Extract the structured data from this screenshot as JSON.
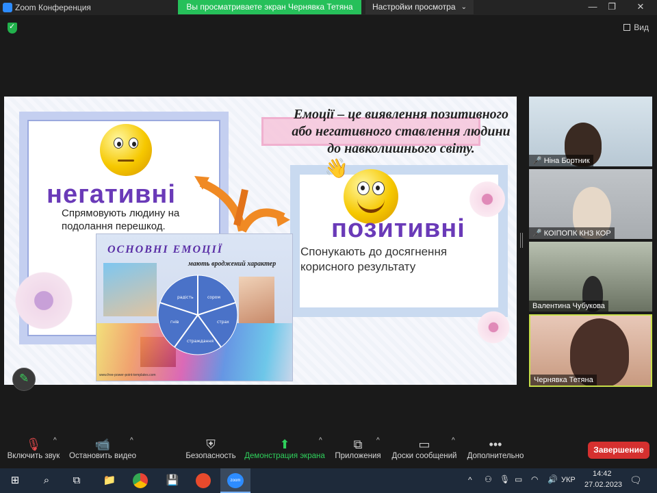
{
  "window": {
    "title": "Zoom Конференция",
    "share_banner": "Вы просматриваете экран Чернявка Тетяна",
    "view_settings": "Настройки просмотра",
    "view_label": "Вид"
  },
  "slide": {
    "definition": "Емоції – це виявлення позитивного або негативного ставлення людини до навколишнього світу.",
    "negative_title": "негативні",
    "negative_desc_1": "Спрямовують людину на",
    "negative_desc_2": "подолання перешкод.",
    "positive_title": "позитивні",
    "positive_desc_1": "Спонукають до  досягнення",
    "positive_desc_2": "корисного результату",
    "panel_title": "ОСНОВНІ   ЕМОЦІЇ",
    "panel_subtitle": "мають вроджений характер",
    "pie_labels": [
      "радість",
      "сором",
      "страх",
      "страждання",
      "гнів"
    ],
    "panel_credit": "www.free-power-point-templates.com"
  },
  "participants": [
    {
      "name": "Ніна Бортник",
      "muted": true
    },
    {
      "name": "КОІПОПК КНЗ КОР",
      "muted": true
    },
    {
      "name": "Валентина Чубукова",
      "muted": false
    },
    {
      "name": "Чернявка Тетяна",
      "muted": false,
      "active": true
    }
  ],
  "toolbar": {
    "unmute": "Включить звук",
    "stop_video": "Остановить видео",
    "security": "Безопасность",
    "share": "Демонстрация экрана",
    "apps": "Приложения",
    "whiteboards": "Доски сообщений",
    "more": "Дополнительно",
    "end": "Завершение"
  },
  "taskbar": {
    "lang": "УКР",
    "time": "14:42",
    "date": "27.02.2023",
    "zoom_label": "zoom"
  },
  "colors": {
    "accent_green": "#26c05a",
    "end_red": "#d5302f",
    "slide_title_purple": "#6a3ab8"
  }
}
